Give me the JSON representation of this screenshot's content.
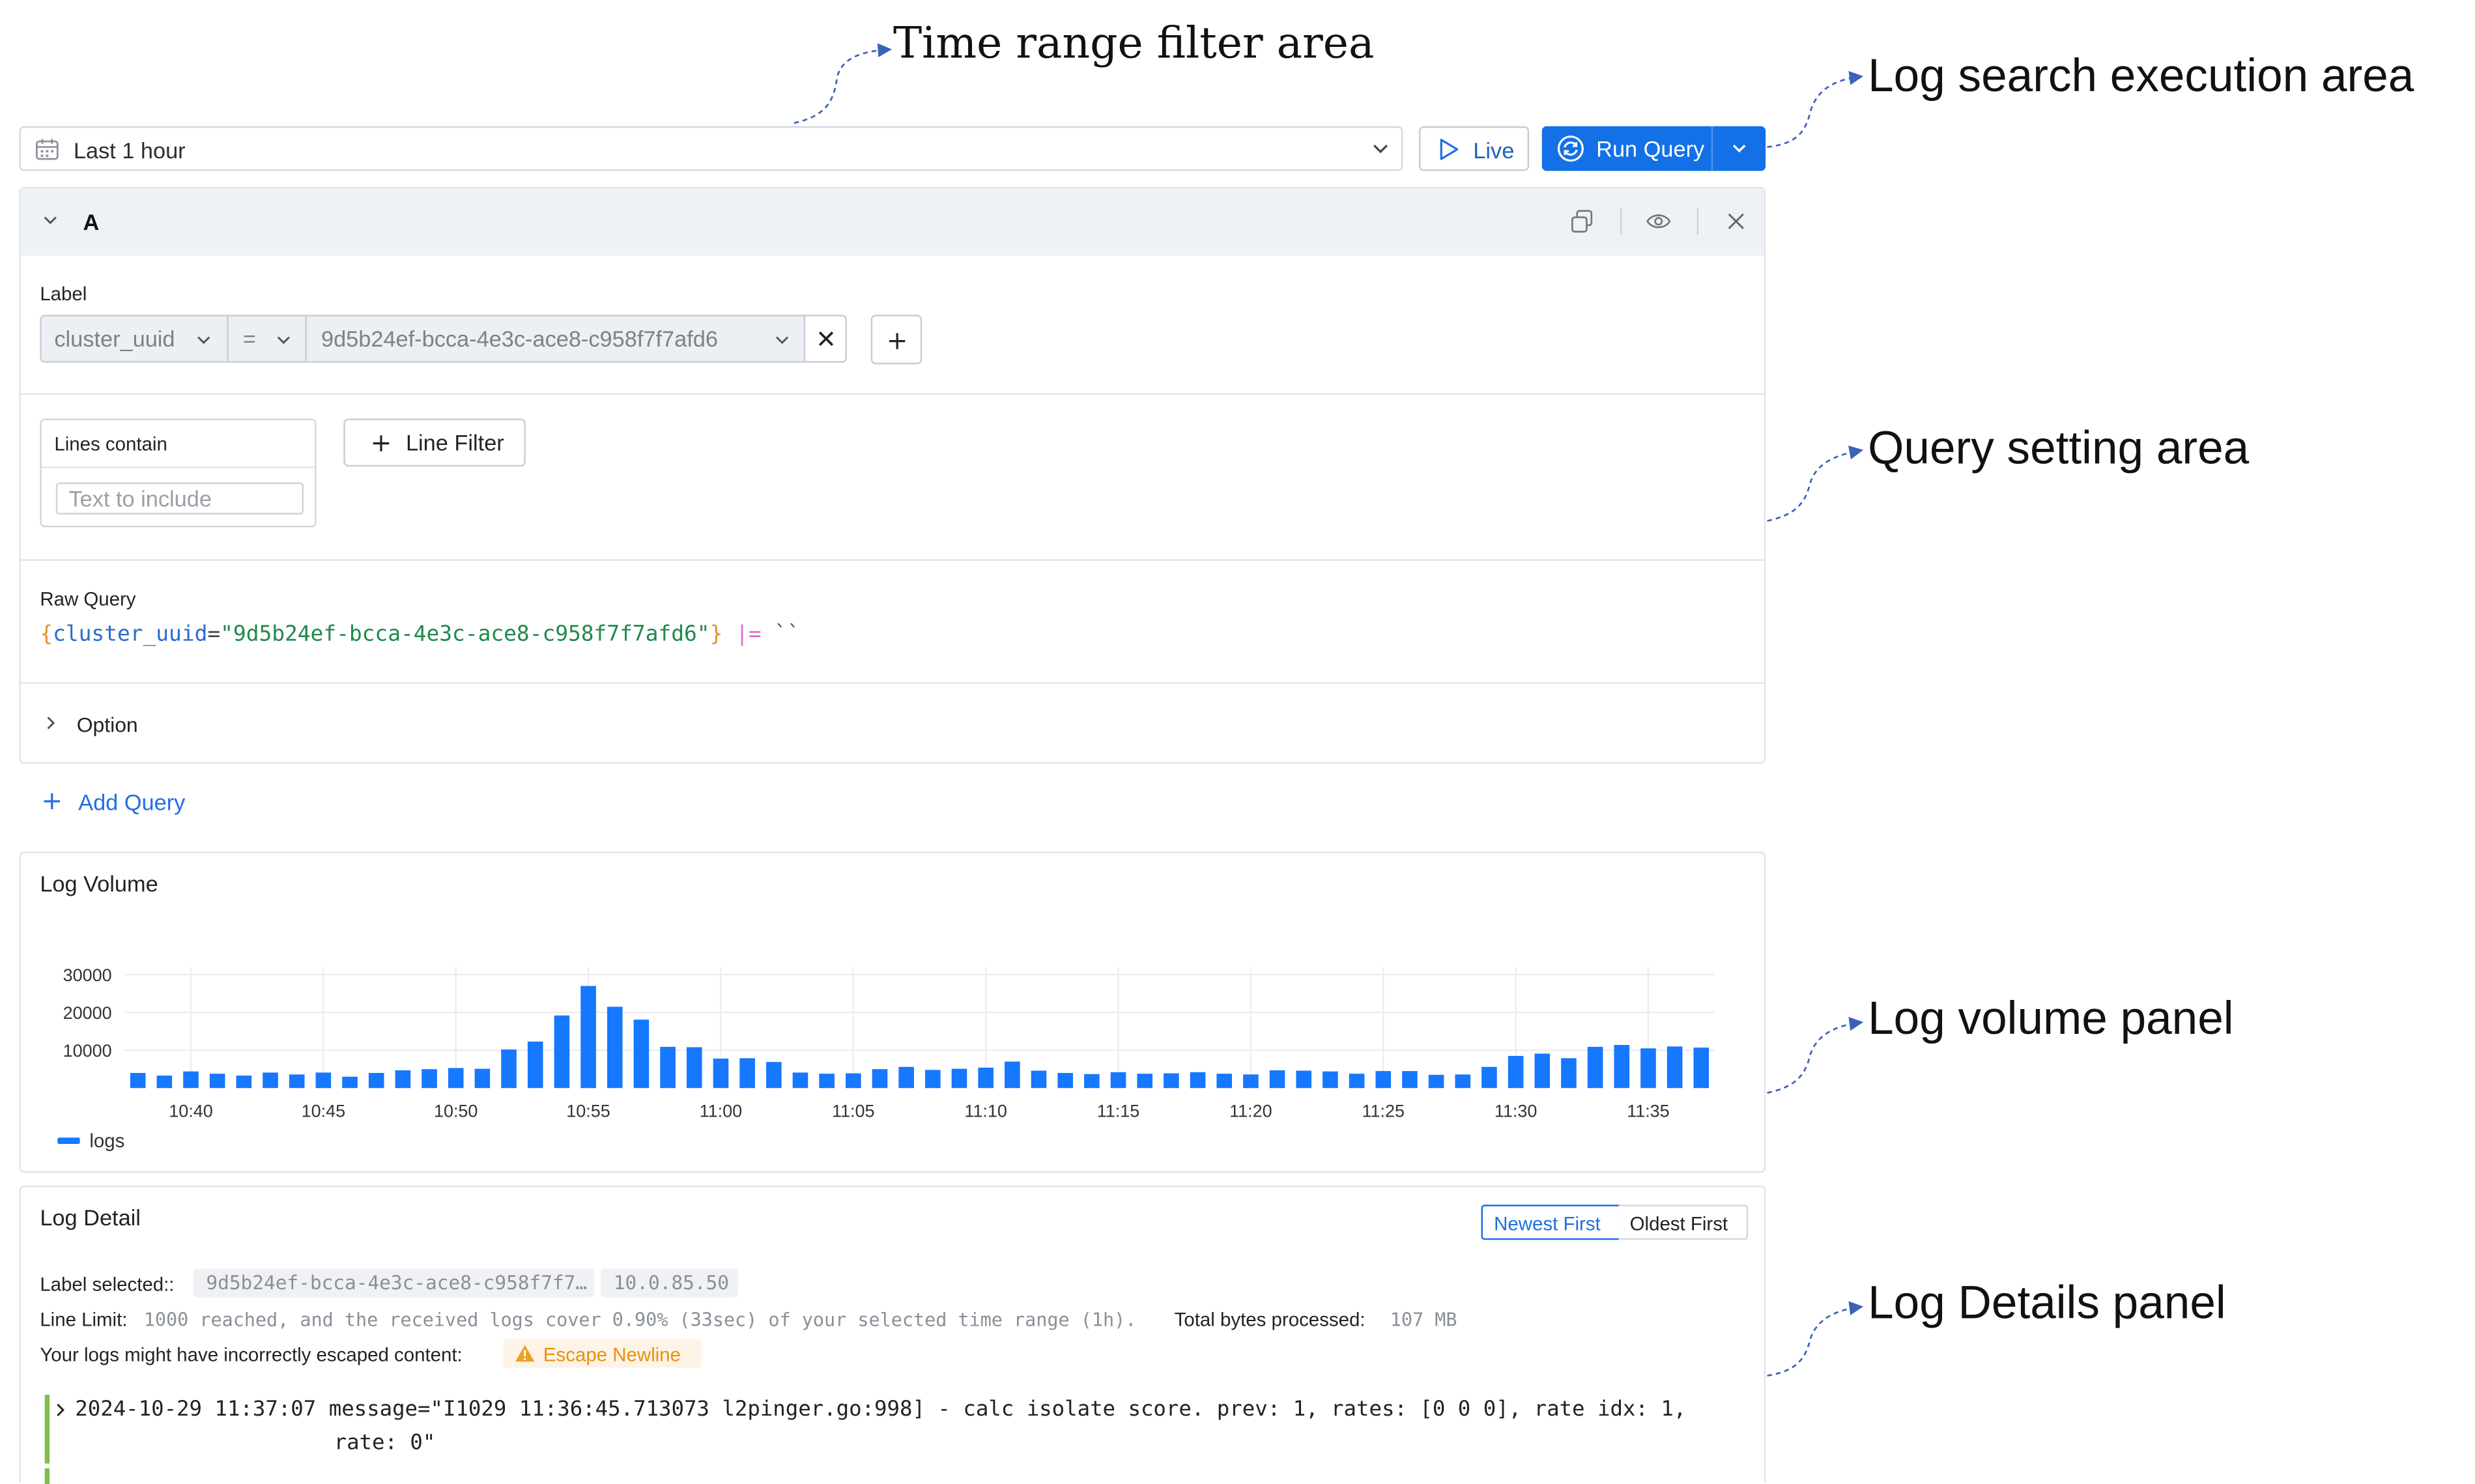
{
  "annotations": {
    "time_range": "Time range filter area",
    "execution": "Log search execution  area",
    "query_setting": "Query setting area",
    "log_volume": "Log volume panel",
    "log_details": "Log Details panel"
  },
  "toolbar": {
    "time_range": "Last 1 hour",
    "live_label": "Live",
    "run_label": "Run Query"
  },
  "query": {
    "name": "A",
    "label_heading": "Label",
    "label_key": "cluster_uuid",
    "operator": "=",
    "label_value": "9d5b24ef-bcca-4e3c-ace8-c958f7f7afd6",
    "lines_contain": "Lines contain",
    "text_placeholder": "Text to include",
    "line_filter": "Line Filter",
    "raw_heading": "Raw Query",
    "raw": {
      "open": "{",
      "key": "cluster_uuid",
      "eq": "=",
      "value": "\"9d5b24ef-bcca-4e3c-ace8-c958f7f7afd6\"",
      "close": "}",
      "pipe": "|=",
      "tail": "``"
    },
    "option": "Option"
  },
  "add_query": "Add Query",
  "log_volume": {
    "title": "Log Volume",
    "legend": "logs"
  },
  "chart_data": {
    "type": "bar",
    "title": "Log Volume",
    "x_ticks": [
      "10:40",
      "10:45",
      "10:50",
      "10:55",
      "11:00",
      "11:05",
      "11:10",
      "11:15",
      "11:20",
      "11:25",
      "11:30",
      "11:35"
    ],
    "y_ticks": [
      "30000",
      "20000",
      "10000"
    ],
    "ylim": [
      0,
      32000
    ],
    "series": [
      {
        "name": "logs",
        "color": "#1677ff",
        "values": [
          4000,
          3300,
          4400,
          3800,
          3300,
          4100,
          3600,
          4100,
          3000,
          4000,
          4700,
          5000,
          5300,
          5100,
          10200,
          12300,
          19200,
          27000,
          21500,
          18100,
          10900,
          10800,
          7800,
          7900,
          6900,
          4100,
          3800,
          3900,
          5000,
          5600,
          4800,
          5100,
          5400,
          7000,
          4600,
          4000,
          3700,
          4200,
          3800,
          3900,
          4200,
          3800,
          3600,
          4700,
          4600,
          4400,
          3800,
          4500,
          4500,
          3500,
          3600,
          5600,
          8500,
          9100,
          7900,
          10900,
          11400,
          10500,
          11000,
          10700
        ]
      }
    ],
    "grid": true,
    "legend_position": "bottom-left"
  },
  "log_detail": {
    "title": "Log Detail",
    "newest": "Newest First",
    "oldest": "Oldest First",
    "label_selected": "Label selected::",
    "label_tag_1": "9d5b24ef-bcca-4e3c-ace8-c958f7f7…",
    "label_tag_2": "10.0.85.50",
    "line_limit": "Line Limit:",
    "line_limit_text": "1000 reached, and the received logs cover 0.90% (33sec) of your selected time range (1h).",
    "bytes_label": "Total bytes processed:",
    "bytes_value": "107 MB",
    "escape_warning": "Your logs might have incorrectly escaped content:",
    "escape_tag": "Escape Newline",
    "entry_line1": "2024-10-29 11:37:07 message=\"I1029 11:36:45.713073 l2pinger.go:998] - calc isolate score. prev: 1, rates: [0 0 0], rate idx: 1,",
    "entry_line2": "rate: 0\""
  },
  "colors": {
    "accent": "#1470e6",
    "bar": "#1677ff",
    "warning": "#f0a020",
    "annotation_arrow": "#3a63b8"
  }
}
